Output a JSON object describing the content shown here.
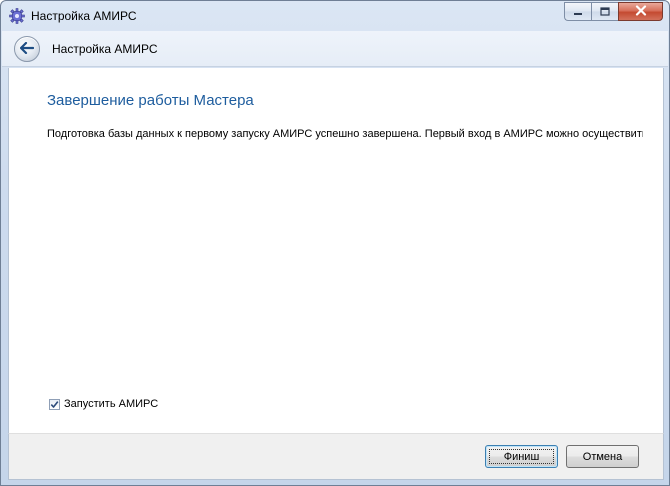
{
  "window": {
    "title": "Настройка АМИРС",
    "icon": "gear-icon",
    "caption_buttons": [
      "minimize-icon",
      "maximize-icon",
      "close-icon"
    ]
  },
  "header": {
    "back_icon": "back-arrow-icon",
    "title": "Настройка АМИРС"
  },
  "page": {
    "title": "Завершение работы Мастера",
    "message": "Подготовка базы данных к первому запуску АМИРС успешно завершена. Первый вход в АМИРС можно осуществить"
  },
  "options": {
    "launch_checkbox": {
      "label": "Запустить АМИРС",
      "checked": true
    }
  },
  "footer": {
    "finish_label": "Финиш",
    "cancel_label": "Отмена"
  },
  "colors": {
    "accent_title": "#1e5d9e",
    "close_button": "#c44a31",
    "frame": "#c5d5ea"
  }
}
